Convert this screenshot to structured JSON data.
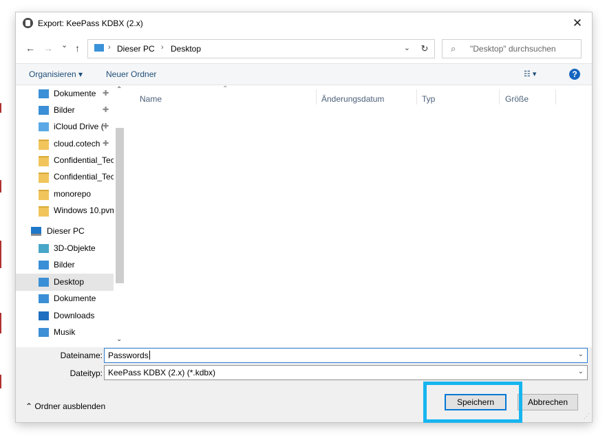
{
  "window": {
    "title": "Export: KeePass KDBX (2.x)",
    "close_symbol": "✕"
  },
  "nav": {
    "back_symbol": "←",
    "forward_symbol": "→",
    "recent_symbol": "⌄",
    "up_symbol": "↑",
    "breadcrumb_sep": "›",
    "breadcrumb": [
      "Dieser PC",
      "Desktop"
    ],
    "address_dropdown_symbol": "⌄",
    "refresh_symbol": "↻",
    "search_placeholder": "\"Desktop\" durchsuchen",
    "search_symbol": "⌕"
  },
  "commands": {
    "organize_label": "Organisieren ▾",
    "new_folder_label": "Neuer Ordner",
    "view_label": "☷ ▾",
    "help_label": "?"
  },
  "sidebar": {
    "items": [
      {
        "label": "Dokumente",
        "icon": "documents-icon",
        "pinned": true
      },
      {
        "label": "Bilder",
        "icon": "pictures-icon",
        "pinned": true
      },
      {
        "label": "iCloud Drive (",
        "icon": "icloud-icon",
        "pinned": true
      },
      {
        "label": "cloud.cotech",
        "icon": "folder-icon",
        "pinned": true
      },
      {
        "label": "Confidential_Tec",
        "icon": "folder-icon",
        "pinned": false
      },
      {
        "label": "Confidential_Tec",
        "icon": "folder-icon",
        "pinned": false
      },
      {
        "label": "monorepo",
        "icon": "folder-icon",
        "pinned": false
      },
      {
        "label": "Windows 10.pvm",
        "icon": "folder-icon",
        "pinned": false
      },
      {
        "label": "Dieser PC",
        "icon": "this-pc-icon",
        "pinned": false
      },
      {
        "label": "3D-Objekte",
        "icon": "3d-objects-icon",
        "pinned": false
      },
      {
        "label": "Bilder",
        "icon": "pictures-icon",
        "pinned": false
      },
      {
        "label": "Desktop",
        "icon": "desktop-icon",
        "pinned": false,
        "selected": true
      },
      {
        "label": "Dokumente",
        "icon": "documents-icon",
        "pinned": false
      },
      {
        "label": "Downloads",
        "icon": "downloads-icon",
        "pinned": false
      },
      {
        "label": "Musik",
        "icon": "music-icon",
        "pinned": false
      }
    ],
    "pin_symbol": "✚",
    "scroll_up_symbol": "⌃",
    "scroll_down_symbol": "⌄"
  },
  "filelist": {
    "sort_symbol": "⌃",
    "columns": [
      "Name",
      "Änderungsdatum",
      "Typ",
      "Größe"
    ]
  },
  "form": {
    "filename_label": "Dateiname:",
    "filename_value": "Passwords",
    "filetype_label": "Dateityp:",
    "filetype_value": "KeePass KDBX (2.x) (*.kdbx)",
    "dropdown_symbol": "⌄"
  },
  "footer": {
    "hide_folders_label": "⌃  Ordner ausblenden",
    "save_label": "Speichern",
    "cancel_label": "Abbrechen",
    "grip_symbol": "⋰"
  },
  "colors": {
    "highlight": "#16b5ef",
    "accent": "#0078d7"
  }
}
